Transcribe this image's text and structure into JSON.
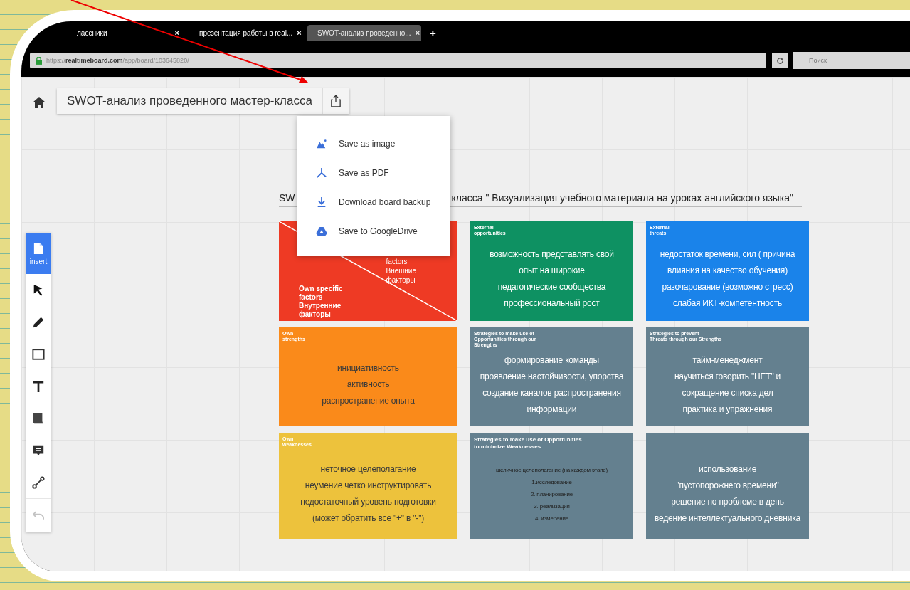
{
  "browser": {
    "tabs": [
      {
        "title": "лассники",
        "selected": false,
        "kind": "plain",
        "close": "×"
      },
      {
        "title": "презентация работы в real...",
        "selected": false,
        "kind": "doc",
        "close": "×"
      },
      {
        "title": "SWOT-анализ проведенно...",
        "selected": true,
        "kind": "page",
        "close": "×"
      }
    ],
    "new_tab": "+",
    "address": {
      "prefix": "https://",
      "host": "realtimeboard.com",
      "path": "/app/board/103645820/"
    },
    "search": {
      "placeholder": "Поиск"
    }
  },
  "board": {
    "title": "SWOT-анализ проведенного мастер-класса",
    "export_menu": [
      {
        "kind": "image",
        "label": "Save as image"
      },
      {
        "kind": "pdf",
        "label": "Save as PDF"
      },
      {
        "kind": "download",
        "label": "Download board backup"
      },
      {
        "kind": "drive",
        "label": "Save to GoogleDrive"
      }
    ],
    "tools": [
      {
        "kind": "insert",
        "label": "insert",
        "selected": true
      },
      {
        "kind": "cursor",
        "selected": false
      },
      {
        "kind": "pen",
        "selected": false
      },
      {
        "kind": "rectangle",
        "selected": false
      },
      {
        "kind": "text",
        "selected": false
      },
      {
        "kind": "sticker",
        "selected": false
      },
      {
        "kind": "comment",
        "selected": false
      },
      {
        "kind": "connector",
        "selected": false
      }
    ],
    "undo": {
      "disabled": true
    },
    "heading": {
      "start": "SW",
      "end": "класса \" Визуализация учебного материала на уроках английского языка\""
    },
    "cards": [
      {
        "kind": "diagonal",
        "color": "#ee3a24",
        "label": "Own specific\nfactors\nВнутренние\nфакторы",
        "corner_label": "factors\nВнешние\nфакторы"
      },
      {
        "kind": "plain",
        "color": "#0e9162",
        "label": "External\nopportunities",
        "text": "возможность представлять свой\nопыт на широкие\nпедагогические сообщества\nпрофессиональный рост"
      },
      {
        "kind": "plain",
        "color": "#1a83ea",
        "label": "External\nthreats",
        "text": "недостаток времени, сил ( причина\nвлияния на качество обучения)\nразочарование (возможно стресс)\nслабая ИКТ-компетентность"
      },
      {
        "kind": "plain",
        "color": "#fa8a1a",
        "label": "Own\nstrengths",
        "text": "инициативность\nактивность\nраспространение опыта"
      },
      {
        "kind": "plain",
        "color": "#64808f",
        "label": "Strategies to make use of\nOpportunities through our\nStrengths",
        "text": "формирование команды\nпроявление настойчивости, упорства\nсоздание каналов распространения\nинформации"
      },
      {
        "kind": "plain",
        "color": "#64808f",
        "label": "Strategies to prevent\nThreats through our Strengths",
        "text": "тайм-менеджмент\nнаучиться говорить \"НЕТ\" и\nсокращение списка дел\nпрактика и упражнения"
      },
      {
        "kind": "plain",
        "color": "#edc23c",
        "label": "Own\nweaknesses",
        "text": "неточное целеполагание\nнеумение четко инструктировать\nнедостаточный уровень подготовки\n(может обратить все \"+\" в \"-\")"
      },
      {
        "kind": "small",
        "color": "#64808f",
        "label": "Strategies to make use of Opportunities\nto minimize Weaknesses",
        "text": "шеличное целеполагание (на каждом этапе)\n1.исследование\n2. планирование\n3. реализация\n4. измерение"
      },
      {
        "kind": "plain",
        "color": "#64808f",
        "text": "использование\n\"пустопорожнего времени\"\nрешение по проблеме в день\nведение интеллектуального дневника"
      }
    ]
  }
}
